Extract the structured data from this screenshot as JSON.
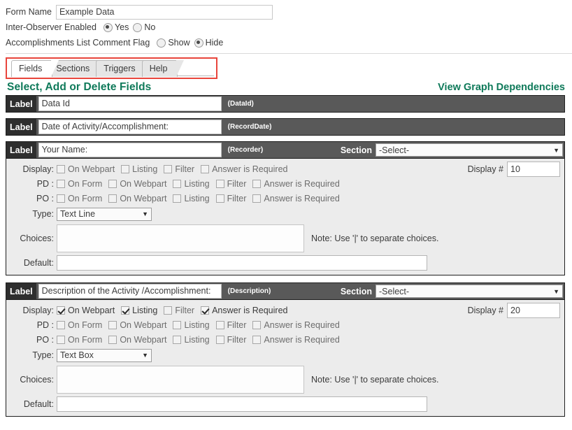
{
  "top_form": {
    "form_name_label": "Form Name",
    "form_name_value": "Example Data",
    "inter_observer_label": "Inter-Observer Enabled",
    "inter_observer_yes": "Yes",
    "inter_observer_no": "No",
    "inter_observer_selected": "Yes",
    "comment_flag_label": "Accomplishments List Comment Flag",
    "comment_flag_show": "Show",
    "comment_flag_hide": "Hide",
    "comment_flag_selected": "Hide"
  },
  "tabs": {
    "items": [
      {
        "label": "Fields",
        "active": true
      },
      {
        "label": "Sections",
        "active": false
      },
      {
        "label": "Triggers",
        "active": false
      },
      {
        "label": "Help",
        "active": false
      }
    ],
    "highlight_color": "#e8453c"
  },
  "section_header": {
    "title": "Select, Add or Delete Fields",
    "link": "View Graph Dependencies",
    "accent_color": "#0f7a5a"
  },
  "common": {
    "label_badge": "Label",
    "section_badge": "Section",
    "display_label": "Display:",
    "pd_label": "PD :",
    "po_label": "PO :",
    "type_label": "Type:",
    "choices_label": "Choices:",
    "default_label": "Default:",
    "display_num_label": "Display #",
    "choices_note": "Note: Use '|' to separate choices.",
    "select_placeholder": "-Select-",
    "caret": "▼",
    "opt_on_webpart": "On Webpart",
    "opt_listing": "Listing",
    "opt_filter": "Filter",
    "opt_answer_required": "Answer is Required",
    "opt_on_form": "On Form"
  },
  "fields": [
    {
      "label_value": "Data Id",
      "system_name": "(DataId)",
      "expanded": false
    },
    {
      "label_value": "Date of Activity/Accomplishment:",
      "system_name": "(RecordDate)",
      "expanded": false
    },
    {
      "label_value": "Your Name:",
      "system_name": "(Recorder)",
      "expanded": true,
      "section_value": "-Select-",
      "display_number": "10",
      "type_value": "Text Line",
      "choices_value": "",
      "default_value": "",
      "display_row": {
        "on_webpart": false,
        "listing": false,
        "filter": false,
        "answer_required": false
      },
      "pd_row": {
        "on_form": false,
        "on_webpart": false,
        "listing": false,
        "filter": false,
        "answer_required": false
      },
      "po_row": {
        "on_form": false,
        "on_webpart": false,
        "listing": false,
        "filter": false,
        "answer_required": false
      }
    },
    {
      "label_value": "Description of the Activity /Accomplishment:",
      "system_name": "(Description)",
      "expanded": true,
      "section_value": "-Select-",
      "display_number": "20",
      "type_value": "Text Box",
      "choices_value": "",
      "default_value": "",
      "display_row": {
        "on_webpart": true,
        "listing": true,
        "filter": false,
        "answer_required": true
      },
      "pd_row": {
        "on_form": false,
        "on_webpart": false,
        "listing": false,
        "filter": false,
        "answer_required": false
      },
      "po_row": {
        "on_form": false,
        "on_webpart": false,
        "listing": false,
        "filter": false,
        "answer_required": false
      }
    }
  ]
}
